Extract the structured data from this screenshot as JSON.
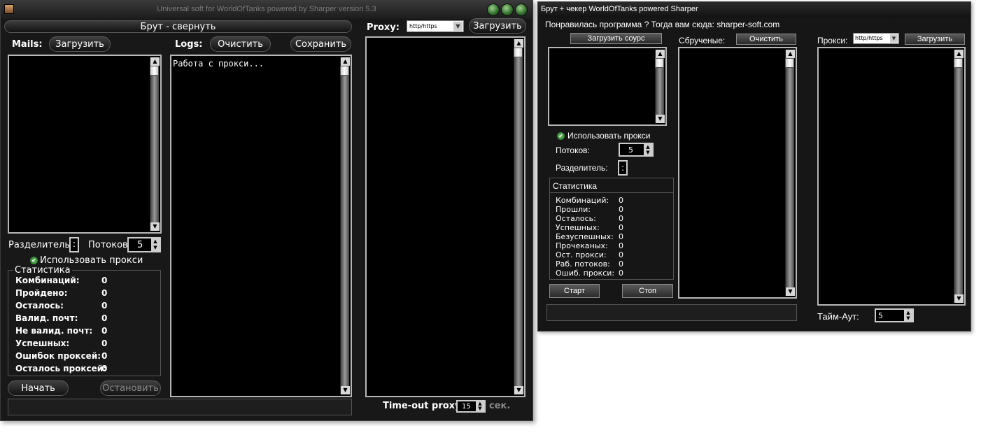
{
  "window1": {
    "title": "Universal soft for WorldOfTanks powered by Sharper version 5.3",
    "header_bar": "Брут - свернуть",
    "mails_label": "Mails:",
    "mails_load": "Загрузить",
    "logs_label": "Logs:",
    "logs_clear": "Очистить",
    "logs_save": "Сохранить",
    "proxy_label": "Proxy:",
    "proxy_type": "http/https",
    "proxy_load": "Загрузить",
    "log_text": "Работа с прокси...",
    "separator_label": "Разделитель",
    "separator_value": ":",
    "threads_label": "Потоков:",
    "threads_value": "5",
    "use_proxy": "Использовать прокси",
    "stats_title": "Статистика",
    "stats": [
      {
        "label": "Комбинаций:",
        "value": "0"
      },
      {
        "label": "Пройдено:",
        "value": "0"
      },
      {
        "label": "Осталось:",
        "value": "0"
      },
      {
        "label": "Валид. почт:",
        "value": "0"
      },
      {
        "label": "Не валид. почт:",
        "value": "0"
      },
      {
        "label": "Успешных:",
        "value": "0"
      },
      {
        "label": "Ошибок проксей:",
        "value": "0"
      },
      {
        "label": "Осталось проксей:",
        "value": "0"
      }
    ],
    "start": "Начать",
    "stop": "Остановить",
    "timeout_label": "Time-out proxy:",
    "timeout_value": "15",
    "timeout_unit": "сек."
  },
  "window2": {
    "title": "Брут + чекер WorldOfTanks powered Sharper",
    "promo": "Понравилась программа ? Тогда вам сюда: sharper-soft.com",
    "load_source": "Загрузить соурс",
    "brute_label": "Сбрученые:",
    "clear": "Очистить",
    "proxy_label": "Прокси:",
    "proxy_type": "http/https",
    "proxy_load": "Загрузить",
    "use_proxy": "Использовать прокси",
    "threads_label": "Потоков:",
    "threads_value": "5",
    "separator_label": "Разделитель:",
    "separator_value": ":",
    "stats_title": "Статистика",
    "stats": [
      {
        "label": "Комбинаций:",
        "value": "0"
      },
      {
        "label": "Прошли:",
        "value": "0"
      },
      {
        "label": "Осталось:",
        "value": "0"
      },
      {
        "label": "Успешных:",
        "value": "0"
      },
      {
        "label": "Безуспешных:",
        "value": "0"
      },
      {
        "label": "Прочеканых:",
        "value": "0"
      },
      {
        "label": "Ост. прокси:",
        "value": "0"
      },
      {
        "label": "Раб. потоков:",
        "value": "0"
      },
      {
        "label": "Ошиб. прокси:",
        "value": "0"
      }
    ],
    "start": "Старт",
    "stop": "Стоп",
    "timeout_label": "Тайм-Аут:",
    "timeout_value": "5"
  }
}
